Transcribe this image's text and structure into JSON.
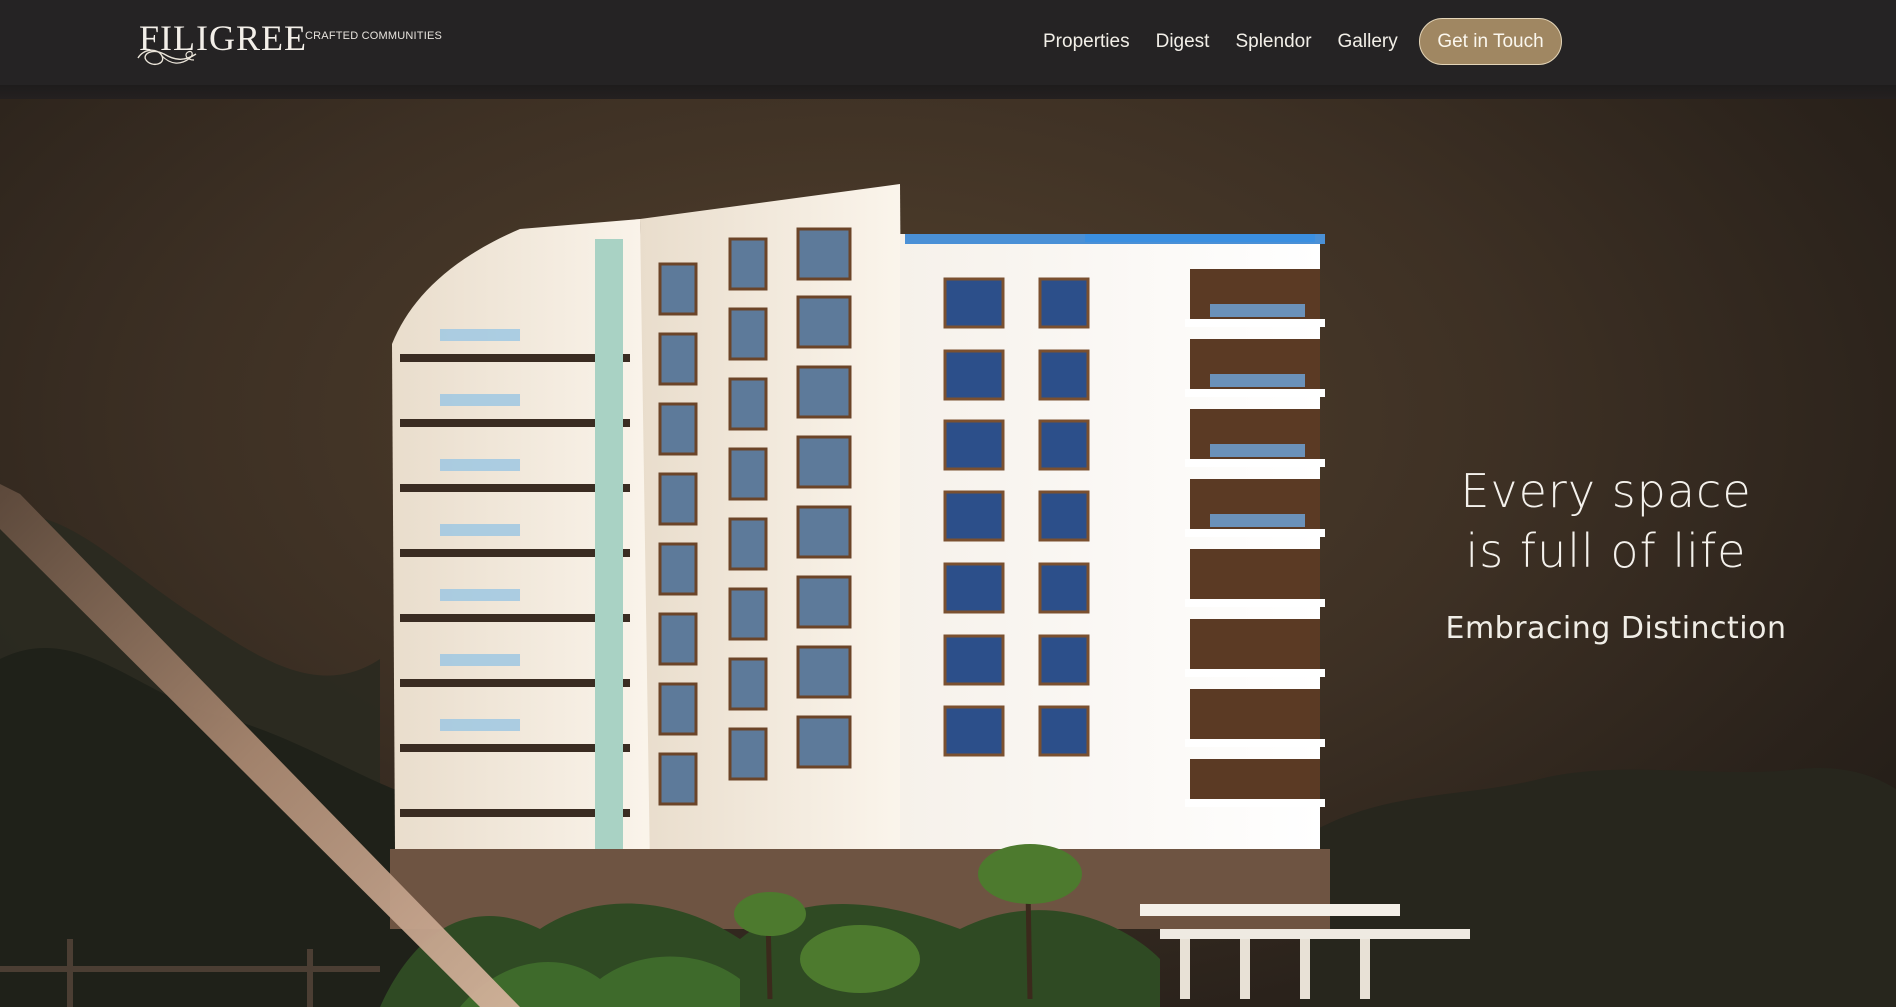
{
  "brand": {
    "name": "FILIGREE",
    "tagline": "CRAFTED COMMUNITIES"
  },
  "nav": {
    "items": [
      {
        "label": "Properties"
      },
      {
        "label": "Digest"
      },
      {
        "label": "Splendor"
      },
      {
        "label": "Gallery"
      }
    ],
    "cta_label": "Get in Touch"
  },
  "hero": {
    "headline_line1": "Every space",
    "headline_line2": "is full of life",
    "subheadline": "Embracing Distinction",
    "image": "residential-tower-image"
  },
  "colors": {
    "header_bg": "#252324",
    "accent": "#a08762",
    "hero_bg": "#3d3024"
  }
}
